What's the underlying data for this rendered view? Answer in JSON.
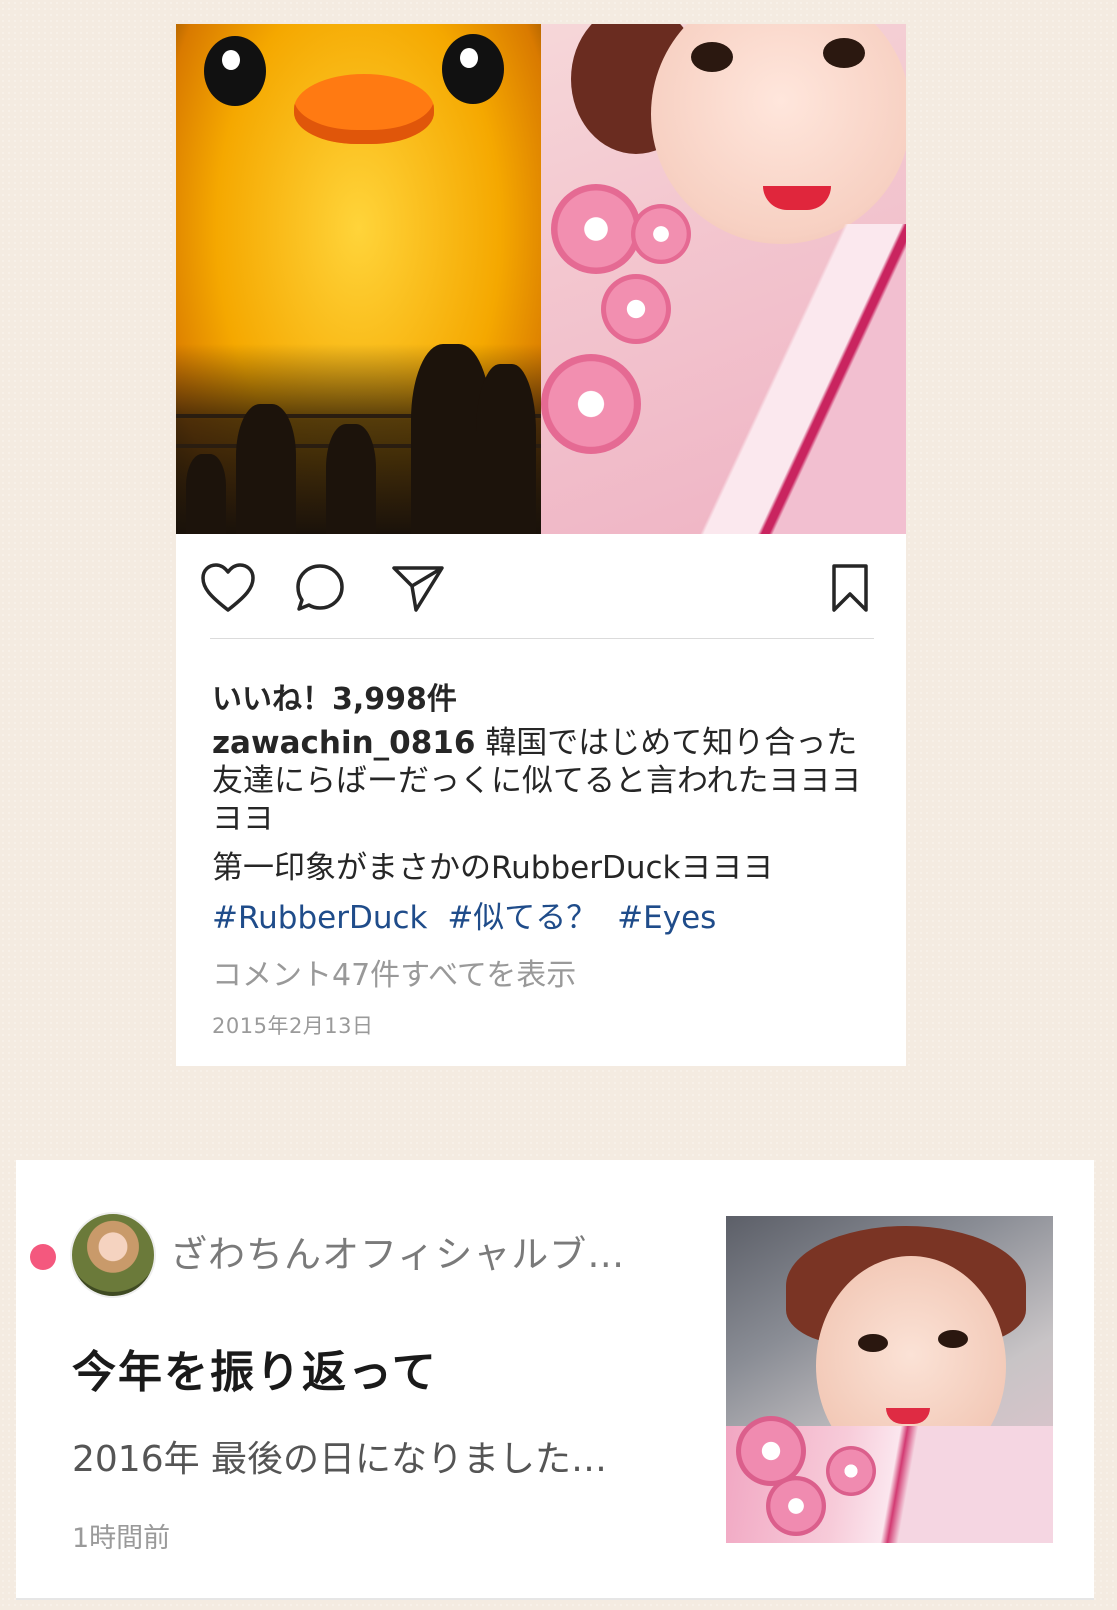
{
  "instagram_post": {
    "likes": "いいね！3,998件",
    "username": "zawachin_0816",
    "caption": "韓国ではじめて知り合った友達にらばーだっくに似てると言われたヨヨヨヨヨ",
    "caption_line2": "第一印象がまさかのRubberDuckヨヨヨ",
    "hashtags": [
      "#RubberDuck",
      "#似てる？",
      "#Eyes"
    ],
    "view_comments": "コメント47件すべてを表示",
    "date": "2015年2月13日",
    "icons": [
      "heart-icon",
      "comment-icon",
      "share-icon",
      "bookmark-icon"
    ]
  },
  "blog_card": {
    "blog_name": "ざわちんオフィシャルブ…",
    "title": "今年を振り返って",
    "excerpt": "2016年 最後の日になりました…",
    "time": "1時間前",
    "unread_dot_color": "#f4587e"
  }
}
